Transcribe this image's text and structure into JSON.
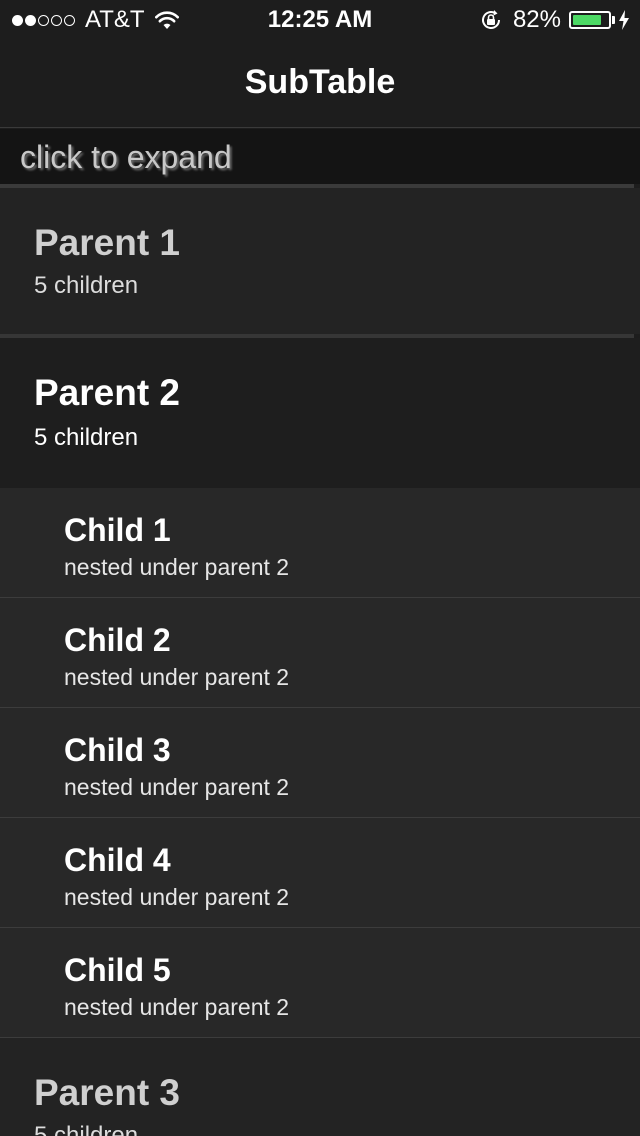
{
  "status_bar": {
    "signal_dots": [
      true,
      true,
      false,
      false,
      false
    ],
    "carrier": "AT&T",
    "time": "12:25 AM",
    "battery_percent_label": "82%",
    "battery_level": 0.82,
    "battery_color": "#4cd964"
  },
  "nav": {
    "title": "SubTable"
  },
  "header": {
    "text": "click to expand"
  },
  "list": {
    "parents": [
      {
        "title": "Parent 1",
        "subtitle": "5 children",
        "expanded": false,
        "children": []
      },
      {
        "title": "Parent 2",
        "subtitle": "5 children",
        "expanded": true,
        "children": [
          {
            "title": "Child 1",
            "subtitle": "nested under parent 2"
          },
          {
            "title": "Child 2",
            "subtitle": "nested under parent 2"
          },
          {
            "title": "Child 3",
            "subtitle": "nested under parent 2"
          },
          {
            "title": "Child 4",
            "subtitle": "nested under parent 2"
          },
          {
            "title": "Child 5",
            "subtitle": "nested under parent 2"
          }
        ]
      },
      {
        "title": "Parent 3",
        "subtitle": "5 children",
        "expanded": false,
        "children": []
      }
    ]
  }
}
